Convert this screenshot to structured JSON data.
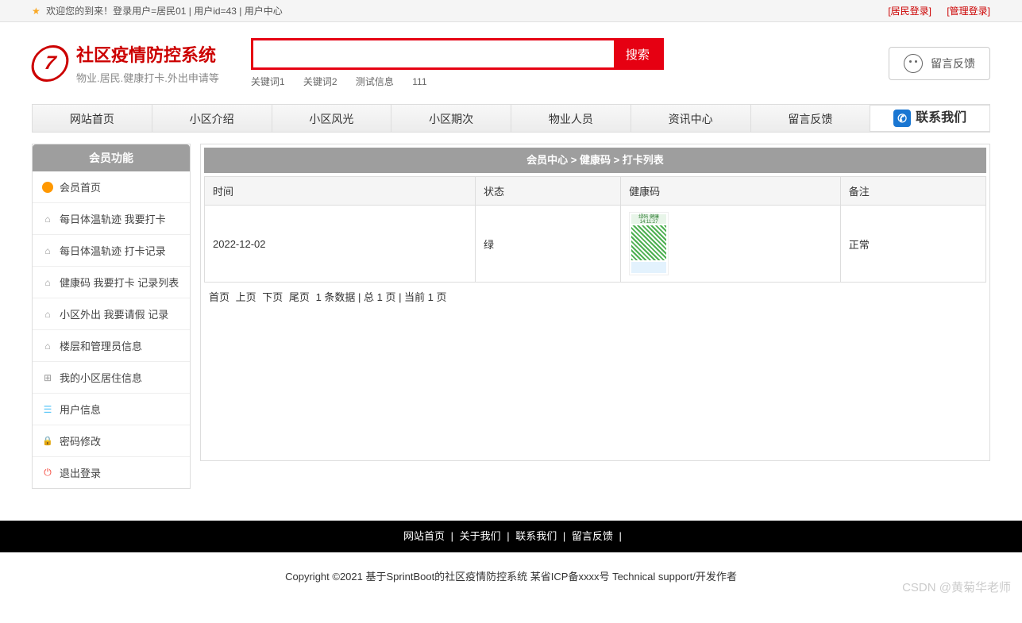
{
  "topbar": {
    "welcome": "欢迎您的到来！登录用户=居民01 | 用户id=43 | 用户中心",
    "login_resident": "[居民登录]",
    "login_admin": "[管理登录]"
  },
  "brand": {
    "title": "社区疫情防控系统",
    "subtitle": "物业.居民.健康打卡.外出申请等"
  },
  "search": {
    "placeholder": "",
    "value": "",
    "button": "搜索",
    "keywords": [
      "关键词1",
      "关键词2",
      "测试信息",
      "111"
    ]
  },
  "feedback_btn": "留言反馈",
  "nav": {
    "items": [
      "网站首页",
      "小区介绍",
      "小区风光",
      "小区期次",
      "物业人员",
      "资讯中心",
      "留言反馈"
    ],
    "contact": "联系我们"
  },
  "sidebar": {
    "title": "会员功能",
    "items": [
      {
        "icon": "dot",
        "label": "会员首页"
      },
      {
        "icon": "home",
        "label": "每日体温轨迹 我要打卡"
      },
      {
        "icon": "home",
        "label": "每日体温轨迹 打卡记录"
      },
      {
        "icon": "home",
        "label": "健康码 我要打卡 记录列表"
      },
      {
        "icon": "home",
        "label": "小区外出 我要请假 记录"
      },
      {
        "icon": "home",
        "label": "楼层和管理员信息"
      },
      {
        "icon": "grid",
        "label": "我的小区居住信息"
      },
      {
        "icon": "user",
        "label": "用户信息"
      },
      {
        "icon": "lock",
        "label": "密码修改"
      },
      {
        "icon": "power",
        "label": "退出登录"
      }
    ]
  },
  "crumbs": "会员中心 > 健康码 > 打卡列表",
  "table": {
    "headers": [
      "时间",
      "状态",
      "健康码",
      "备注"
    ],
    "rows": [
      {
        "time": "2022-12-02",
        "status": "绿",
        "qr_head": "绿码 健康",
        "qr_time": "14:11:27",
        "remark": "正常"
      }
    ]
  },
  "pager": {
    "first": "首页",
    "prev": "上页",
    "next": "下页",
    "last": "尾页",
    "summary": "1 条数据 | 总 1 页 | 当前 1 页"
  },
  "footer_nav": {
    "items": [
      "网站首页",
      "关于我们",
      "联系我们",
      "留言反馈"
    ]
  },
  "copyright": "Copyright ©2021 基于SprintBoot的社区疫情防控系统    某省ICP备xxxx号    Technical support/开发作者",
  "watermark": "CSDN @黄菊华老师"
}
